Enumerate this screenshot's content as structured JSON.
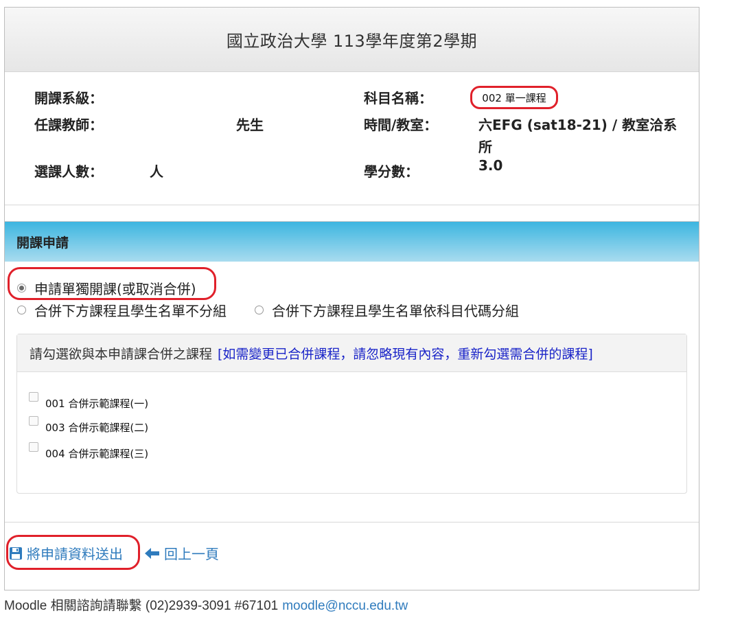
{
  "header": {
    "title": "國立政治大學 113學年度第2學期"
  },
  "info": {
    "department_label": "開課系級：",
    "course_name_label": "科目名稱：",
    "course_name_value": "002 單一課程",
    "teacher_label": "任課教師：",
    "teacher_value": "先生",
    "time_room_label": "時間/教室：",
    "time_room_value_line1": "六EFG (sat18-21) / 教室洽系",
    "time_room_value_line2": "所",
    "enrollment_label": "選課人數：",
    "enrollment_unit": "人",
    "credits_label": "學分數：",
    "credits_value": "3.0"
  },
  "apply": {
    "heading": "開課申請",
    "options": [
      {
        "label": "申請單獨開課(或取消合併)",
        "selected": true
      },
      {
        "label": "合併下方課程且學生名單不分組",
        "selected": false
      },
      {
        "label": "合併下方課程且學生名單依科目代碼分組",
        "selected": false
      }
    ]
  },
  "merge": {
    "heading": "請勾選欲與本申請課合併之課程",
    "note": "[如需變更已合併課程，請忽略現有內容，重新勾選需合併的課程]",
    "courses": [
      {
        "label": "001 合併示範課程(一)",
        "checked": false
      },
      {
        "label": "003 合併示範課程(二)",
        "checked": false
      },
      {
        "label": "004 合併示範課程(三)",
        "checked": false
      }
    ]
  },
  "actions": {
    "submit_label": "將申請資料送出",
    "back_label": "回上一頁"
  },
  "footer": {
    "text": "Moodle 相關諮詢請聯繫 (02)2939-3091 #67101",
    "email": "moodle@nccu.edu.tw"
  },
  "colors": {
    "highlight": "#e0202a",
    "link": "#2f7bbd",
    "note": "#1a24c8",
    "heading_gradient_top": "#3cb5e0"
  },
  "icons": {
    "submit": "floppy-disk-icon",
    "back": "arrow-left-icon"
  }
}
